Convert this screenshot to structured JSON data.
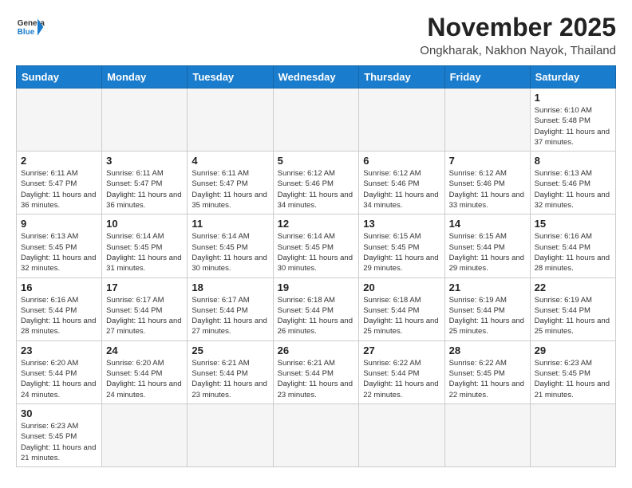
{
  "header": {
    "logo_general": "General",
    "logo_blue": "Blue",
    "month_title": "November 2025",
    "location": "Ongkharak, Nakhon Nayok, Thailand"
  },
  "weekdays": [
    "Sunday",
    "Monday",
    "Tuesday",
    "Wednesday",
    "Thursday",
    "Friday",
    "Saturday"
  ],
  "days": {
    "1": {
      "sunrise": "Sunrise: 6:10 AM",
      "sunset": "Sunset: 5:48 PM",
      "daylight": "Daylight: 11 hours and 37 minutes."
    },
    "2": {
      "sunrise": "Sunrise: 6:11 AM",
      "sunset": "Sunset: 5:47 PM",
      "daylight": "Daylight: 11 hours and 36 minutes."
    },
    "3": {
      "sunrise": "Sunrise: 6:11 AM",
      "sunset": "Sunset: 5:47 PM",
      "daylight": "Daylight: 11 hours and 36 minutes."
    },
    "4": {
      "sunrise": "Sunrise: 6:11 AM",
      "sunset": "Sunset: 5:47 PM",
      "daylight": "Daylight: 11 hours and 35 minutes."
    },
    "5": {
      "sunrise": "Sunrise: 6:12 AM",
      "sunset": "Sunset: 5:46 PM",
      "daylight": "Daylight: 11 hours and 34 minutes."
    },
    "6": {
      "sunrise": "Sunrise: 6:12 AM",
      "sunset": "Sunset: 5:46 PM",
      "daylight": "Daylight: 11 hours and 34 minutes."
    },
    "7": {
      "sunrise": "Sunrise: 6:12 AM",
      "sunset": "Sunset: 5:46 PM",
      "daylight": "Daylight: 11 hours and 33 minutes."
    },
    "8": {
      "sunrise": "Sunrise: 6:13 AM",
      "sunset": "Sunset: 5:46 PM",
      "daylight": "Daylight: 11 hours and 32 minutes."
    },
    "9": {
      "sunrise": "Sunrise: 6:13 AM",
      "sunset": "Sunset: 5:45 PM",
      "daylight": "Daylight: 11 hours and 32 minutes."
    },
    "10": {
      "sunrise": "Sunrise: 6:14 AM",
      "sunset": "Sunset: 5:45 PM",
      "daylight": "Daylight: 11 hours and 31 minutes."
    },
    "11": {
      "sunrise": "Sunrise: 6:14 AM",
      "sunset": "Sunset: 5:45 PM",
      "daylight": "Daylight: 11 hours and 30 minutes."
    },
    "12": {
      "sunrise": "Sunrise: 6:14 AM",
      "sunset": "Sunset: 5:45 PM",
      "daylight": "Daylight: 11 hours and 30 minutes."
    },
    "13": {
      "sunrise": "Sunrise: 6:15 AM",
      "sunset": "Sunset: 5:45 PM",
      "daylight": "Daylight: 11 hours and 29 minutes."
    },
    "14": {
      "sunrise": "Sunrise: 6:15 AM",
      "sunset": "Sunset: 5:44 PM",
      "daylight": "Daylight: 11 hours and 29 minutes."
    },
    "15": {
      "sunrise": "Sunrise: 6:16 AM",
      "sunset": "Sunset: 5:44 PM",
      "daylight": "Daylight: 11 hours and 28 minutes."
    },
    "16": {
      "sunrise": "Sunrise: 6:16 AM",
      "sunset": "Sunset: 5:44 PM",
      "daylight": "Daylight: 11 hours and 28 minutes."
    },
    "17": {
      "sunrise": "Sunrise: 6:17 AM",
      "sunset": "Sunset: 5:44 PM",
      "daylight": "Daylight: 11 hours and 27 minutes."
    },
    "18": {
      "sunrise": "Sunrise: 6:17 AM",
      "sunset": "Sunset: 5:44 PM",
      "daylight": "Daylight: 11 hours and 27 minutes."
    },
    "19": {
      "sunrise": "Sunrise: 6:18 AM",
      "sunset": "Sunset: 5:44 PM",
      "daylight": "Daylight: 11 hours and 26 minutes."
    },
    "20": {
      "sunrise": "Sunrise: 6:18 AM",
      "sunset": "Sunset: 5:44 PM",
      "daylight": "Daylight: 11 hours and 25 minutes."
    },
    "21": {
      "sunrise": "Sunrise: 6:19 AM",
      "sunset": "Sunset: 5:44 PM",
      "daylight": "Daylight: 11 hours and 25 minutes."
    },
    "22": {
      "sunrise": "Sunrise: 6:19 AM",
      "sunset": "Sunset: 5:44 PM",
      "daylight": "Daylight: 11 hours and 25 minutes."
    },
    "23": {
      "sunrise": "Sunrise: 6:20 AM",
      "sunset": "Sunset: 5:44 PM",
      "daylight": "Daylight: 11 hours and 24 minutes."
    },
    "24": {
      "sunrise": "Sunrise: 6:20 AM",
      "sunset": "Sunset: 5:44 PM",
      "daylight": "Daylight: 11 hours and 24 minutes."
    },
    "25": {
      "sunrise": "Sunrise: 6:21 AM",
      "sunset": "Sunset: 5:44 PM",
      "daylight": "Daylight: 11 hours and 23 minutes."
    },
    "26": {
      "sunrise": "Sunrise: 6:21 AM",
      "sunset": "Sunset: 5:44 PM",
      "daylight": "Daylight: 11 hours and 23 minutes."
    },
    "27": {
      "sunrise": "Sunrise: 6:22 AM",
      "sunset": "Sunset: 5:44 PM",
      "daylight": "Daylight: 11 hours and 22 minutes."
    },
    "28": {
      "sunrise": "Sunrise: 6:22 AM",
      "sunset": "Sunset: 5:45 PM",
      "daylight": "Daylight: 11 hours and 22 minutes."
    },
    "29": {
      "sunrise": "Sunrise: 6:23 AM",
      "sunset": "Sunset: 5:45 PM",
      "daylight": "Daylight: 11 hours and 21 minutes."
    },
    "30": {
      "sunrise": "Sunrise: 6:23 AM",
      "sunset": "Sunset: 5:45 PM",
      "daylight": "Daylight: 11 hours and 21 minutes."
    }
  }
}
